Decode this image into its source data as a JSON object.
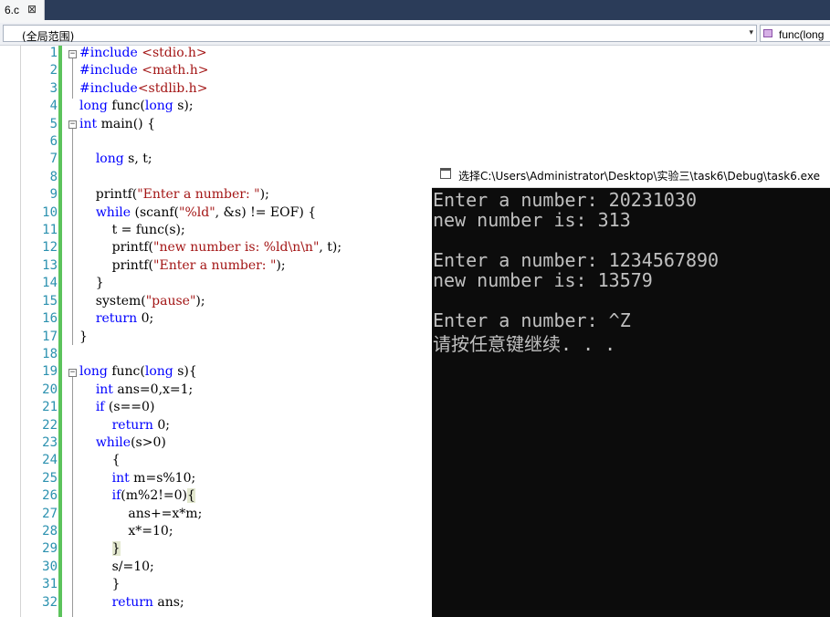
{
  "tab": {
    "filename": "6.c",
    "close": "⊠"
  },
  "navbar": {
    "scope": "(全局范围)",
    "function": "func(long"
  },
  "editor": {
    "line_numbers": [
      "1",
      "2",
      "3",
      "4",
      "5",
      "6",
      "7",
      "8",
      "9",
      "10",
      "11",
      "12",
      "13",
      "14",
      "15",
      "16",
      "17",
      "18",
      "19",
      "20",
      "21",
      "22",
      "23",
      "24",
      "25",
      "26",
      "27",
      "28",
      "29",
      "30",
      "31",
      "32"
    ],
    "code": [
      "#include <stdio.h>",
      "#include <math.h>",
      "#include<stdlib.h>",
      "long func(long s);",
      "int main() {",
      "",
      "    long s, t;",
      "",
      "    printf(\"Enter a number: \");",
      "    while (scanf(\"%ld\", &s) != EOF) {",
      "        t = func(s);",
      "        printf(\"new number is: %ld\\n\\n\", t);",
      "        printf(\"Enter a number: \");",
      "    }",
      "    system(\"pause\");",
      "    return 0;",
      "}",
      "",
      "long func(long s){",
      "    int ans=0,x=1;",
      "    if (s==0)",
      "        return 0;",
      "    while(s>0)",
      "        {",
      "        int m=s%10;",
      "        if(m%2!=0){",
      "            ans+=x*m;",
      "            x*=10;",
      "        }",
      "        s/=10;",
      "        }",
      "        return ans;"
    ]
  },
  "console": {
    "title": "选择C:\\Users\\Administrator\\Desktop\\实验三\\task6\\Debug\\task6.exe",
    "lines": [
      "Enter a number: 20231030",
      "new number is: 313",
      "",
      "Enter a number: 1234567890",
      "new number is: 13579",
      "",
      "Enter a number: ^Z",
      "请按任意键继续. . ."
    ]
  }
}
